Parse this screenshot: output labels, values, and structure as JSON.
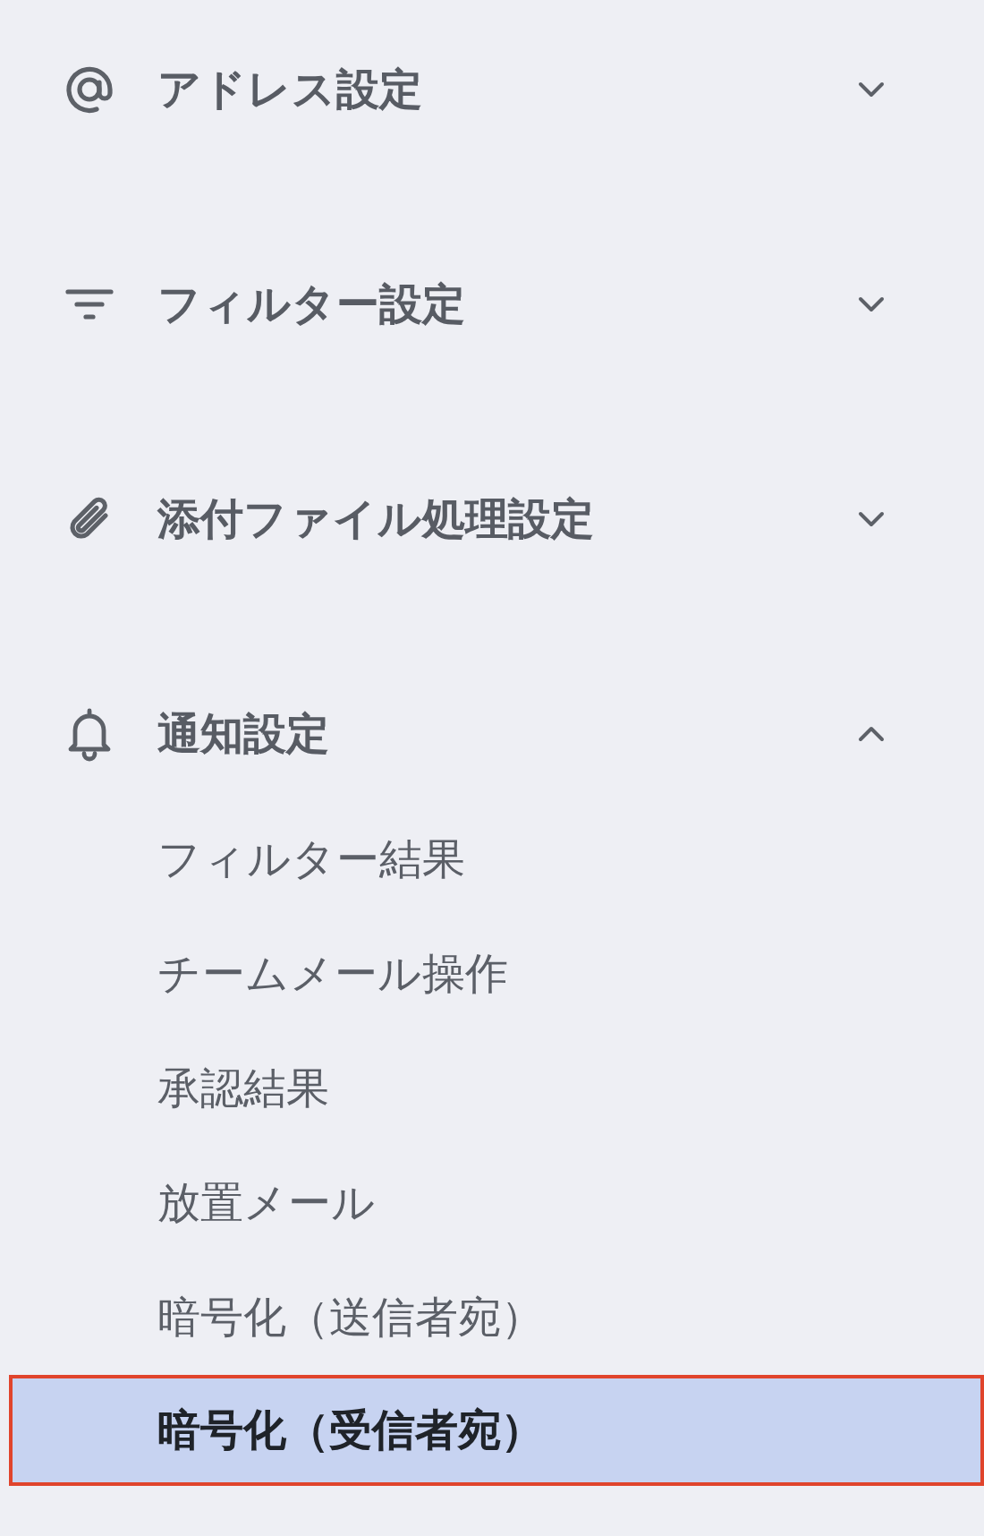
{
  "sections": [
    {
      "label": "アドレス設定",
      "expanded": false
    },
    {
      "label": "フィルター設定",
      "expanded": false
    },
    {
      "label": "添付ファイル処理設定",
      "expanded": false
    },
    {
      "label": "通知設定",
      "expanded": true,
      "items": [
        {
          "label": "フィルター結果",
          "selected": false
        },
        {
          "label": "チームメール操作",
          "selected": false
        },
        {
          "label": "承認結果",
          "selected": false
        },
        {
          "label": "放置メール",
          "selected": false
        },
        {
          "label": "暗号化（送信者宛）",
          "selected": false
        },
        {
          "label": "暗号化（受信者宛）",
          "selected": true
        }
      ]
    }
  ]
}
